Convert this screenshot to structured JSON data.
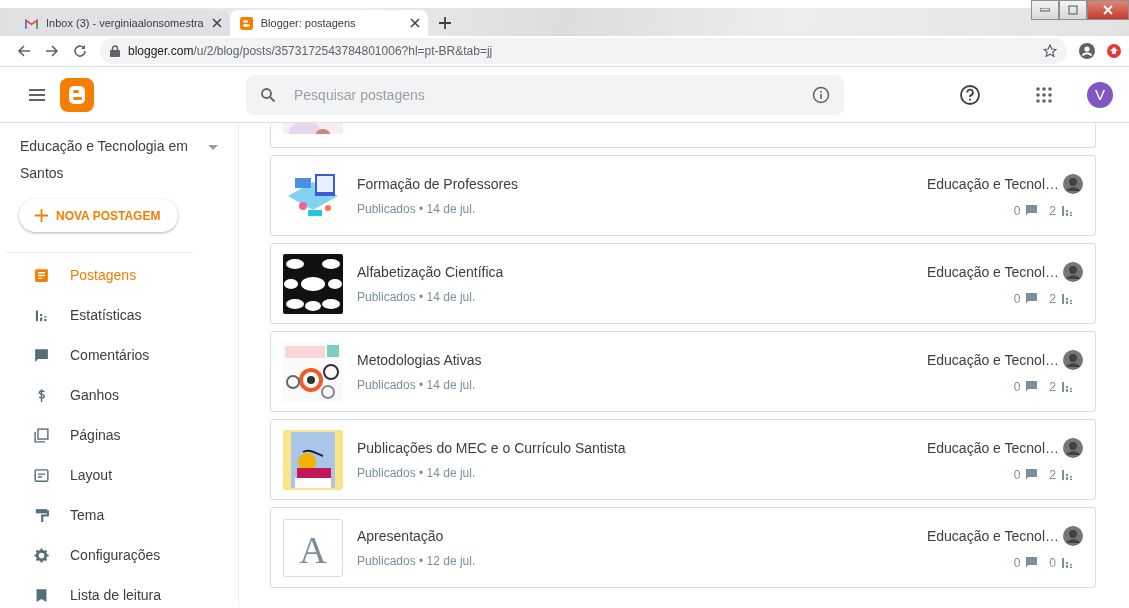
{
  "browser": {
    "tabs": [
      {
        "title": "Inbox (3) - verginiaalonsomestra",
        "kind": "mail",
        "selected": false
      },
      {
        "title": "Blogger: postagens",
        "kind": "blogger",
        "selected": true
      }
    ],
    "address": {
      "domain": "blogger.com",
      "path": "/u/2/blog/posts/3573172543784801006?hl=pt-BR&tab=jj"
    }
  },
  "header": {
    "search": {
      "placeholder": "Pesquisar postagens"
    },
    "avatar": "V"
  },
  "sidebar": {
    "blog_name": "Educação e Tecnologia em Santos",
    "new_post": "NOVA POSTAGEM",
    "items": [
      {
        "label": "Postagens",
        "kind": "posts",
        "selected": true
      },
      {
        "label": "Estatísticas",
        "kind": "stats",
        "selected": false
      },
      {
        "label": "Comentários",
        "kind": "comments",
        "selected": false
      },
      {
        "label": "Ganhos",
        "kind": "earnings",
        "selected": false
      },
      {
        "label": "Páginas",
        "kind": "pages",
        "selected": false
      },
      {
        "label": "Layout",
        "kind": "layout",
        "selected": false
      },
      {
        "label": "Tema",
        "kind": "theme",
        "selected": false
      },
      {
        "label": "Configurações",
        "kind": "settings",
        "selected": false
      },
      {
        "label": "Lista de leitura",
        "kind": "reading",
        "selected": false
      }
    ]
  },
  "posts": [
    {
      "title": "Formação de Professores",
      "meta": "Publicados • 14 de jul.",
      "author": "Educação e Tecnol…",
      "comments": "0",
      "views": "2"
    },
    {
      "title": "Alfabetização Científica",
      "meta": "Publicados • 14 de jul.",
      "author": "Educação e Tecnol…",
      "comments": "0",
      "views": "2"
    },
    {
      "title": "Metodologias Ativas",
      "meta": "Publicados • 14 de jul.",
      "author": "Educação e Tecnol…",
      "comments": "0",
      "views": "2"
    },
    {
      "title": "Publicações do MEC e o Currículo Santista",
      "meta": "Publicados • 14 de jul.",
      "author": "Educação e Tecnol…",
      "comments": "0",
      "views": "2"
    },
    {
      "title": "Apresentação",
      "meta": "Publicados • 12 de jul.",
      "author": "Educação e Tecnol…",
      "comments": "0",
      "views": "0",
      "thumbnail": {
        "kind": "letter",
        "letter": "A"
      }
    }
  ]
}
